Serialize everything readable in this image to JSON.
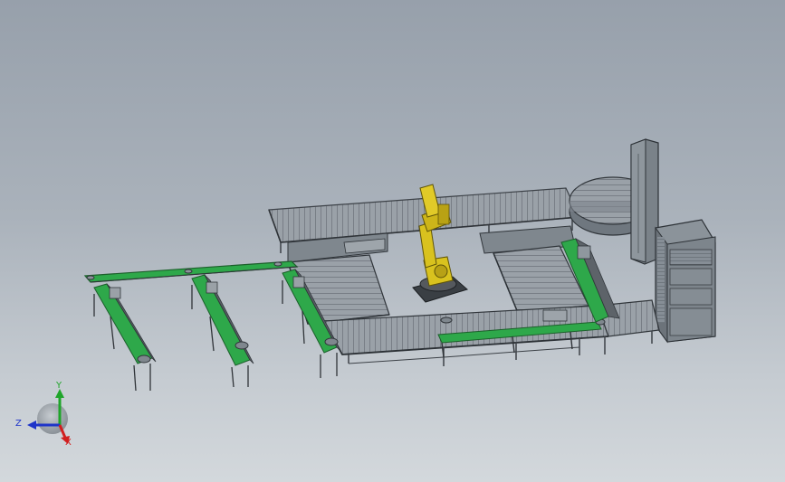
{
  "scene": {
    "background_top": "#97a0ab",
    "background_bottom": "#d3d8dc",
    "colors": {
      "conveyor_green": "#2ea84a",
      "roller_gray": "#8a9299",
      "frame_dark": "#3c4147",
      "robot_yellow": "#d9c21e",
      "cabinet_gray": "#7c848c"
    }
  },
  "triad": {
    "x_label": "X",
    "y_label": "Y",
    "z_label": "Z",
    "x_color": "#d11f1f",
    "y_color": "#1fa52a",
    "z_color": "#1f35c9"
  }
}
